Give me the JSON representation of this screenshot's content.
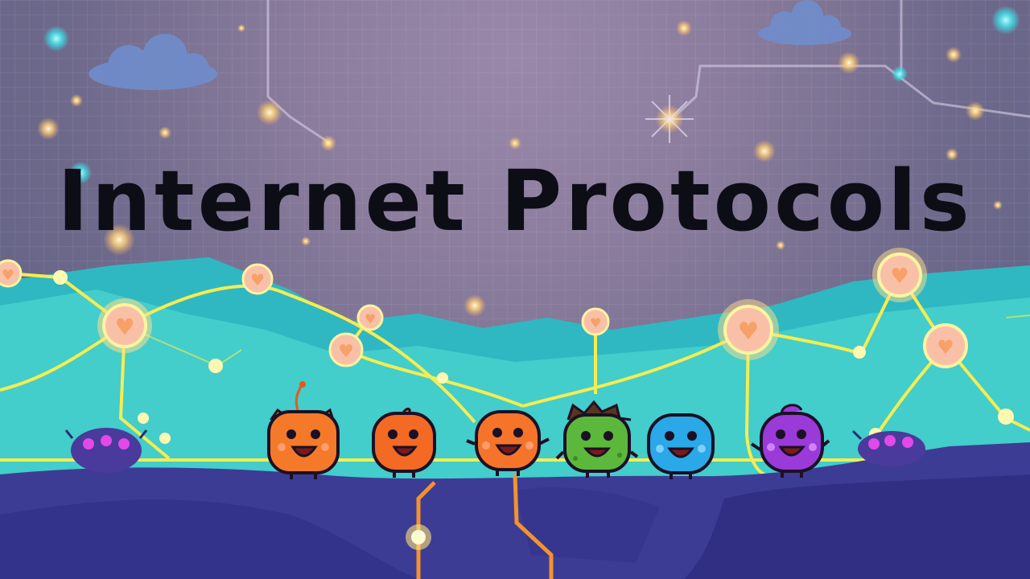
{
  "title": "Internet Protocols",
  "colors": {
    "sky": "#8a7c9c",
    "mountains": "#3cc6c8",
    "ground": "#3b3a8c",
    "network_lines": "#f2e84a",
    "nodes": "#f7b3a8",
    "underground_lines": "#f08a2a"
  },
  "characters": [
    {
      "name": "orange-cat-character",
      "color": "#f47a2a"
    },
    {
      "name": "orange-sprout-character",
      "color": "#f26a24"
    },
    {
      "name": "orange-round-character",
      "color": "#f5742a"
    },
    {
      "name": "green-spiky-character",
      "color": "#5cb83a"
    },
    {
      "name": "blue-character",
      "color": "#2aa8e8"
    },
    {
      "name": "purple-character",
      "color": "#9a3ad8"
    }
  ],
  "icons": [
    "cloud-icon",
    "heart-node-icon",
    "bug-icon",
    "glow-dot-icon"
  ]
}
